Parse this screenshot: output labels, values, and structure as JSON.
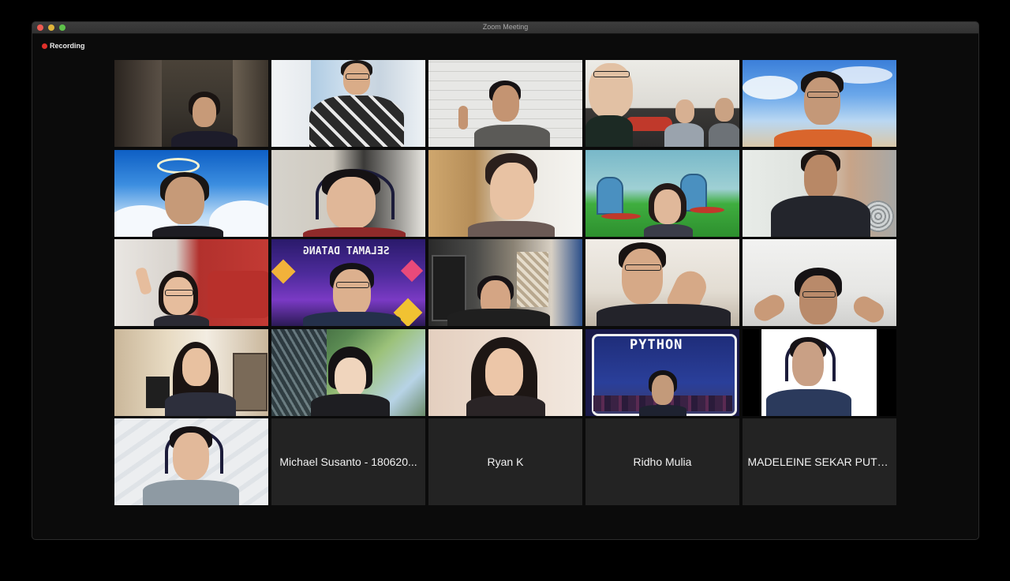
{
  "window": {
    "title": "Zoom Meeting"
  },
  "recording": {
    "label": "Recording"
  },
  "tiles_name_only": [
    {
      "name": "Michael Susanto - 180620..."
    },
    {
      "name": "Ryan K"
    },
    {
      "name": "Ridho Mulia"
    },
    {
      "name": "MADELEINE SEKAR PUTRI..."
    }
  ],
  "background_text": {
    "python_banner": "PYTHON",
    "welcome_banner": "SELAMAT DATANG"
  },
  "colors": {
    "recording_dot": "#e0302a",
    "tile_background": "#232323",
    "window_background": "#0b0b0b"
  }
}
